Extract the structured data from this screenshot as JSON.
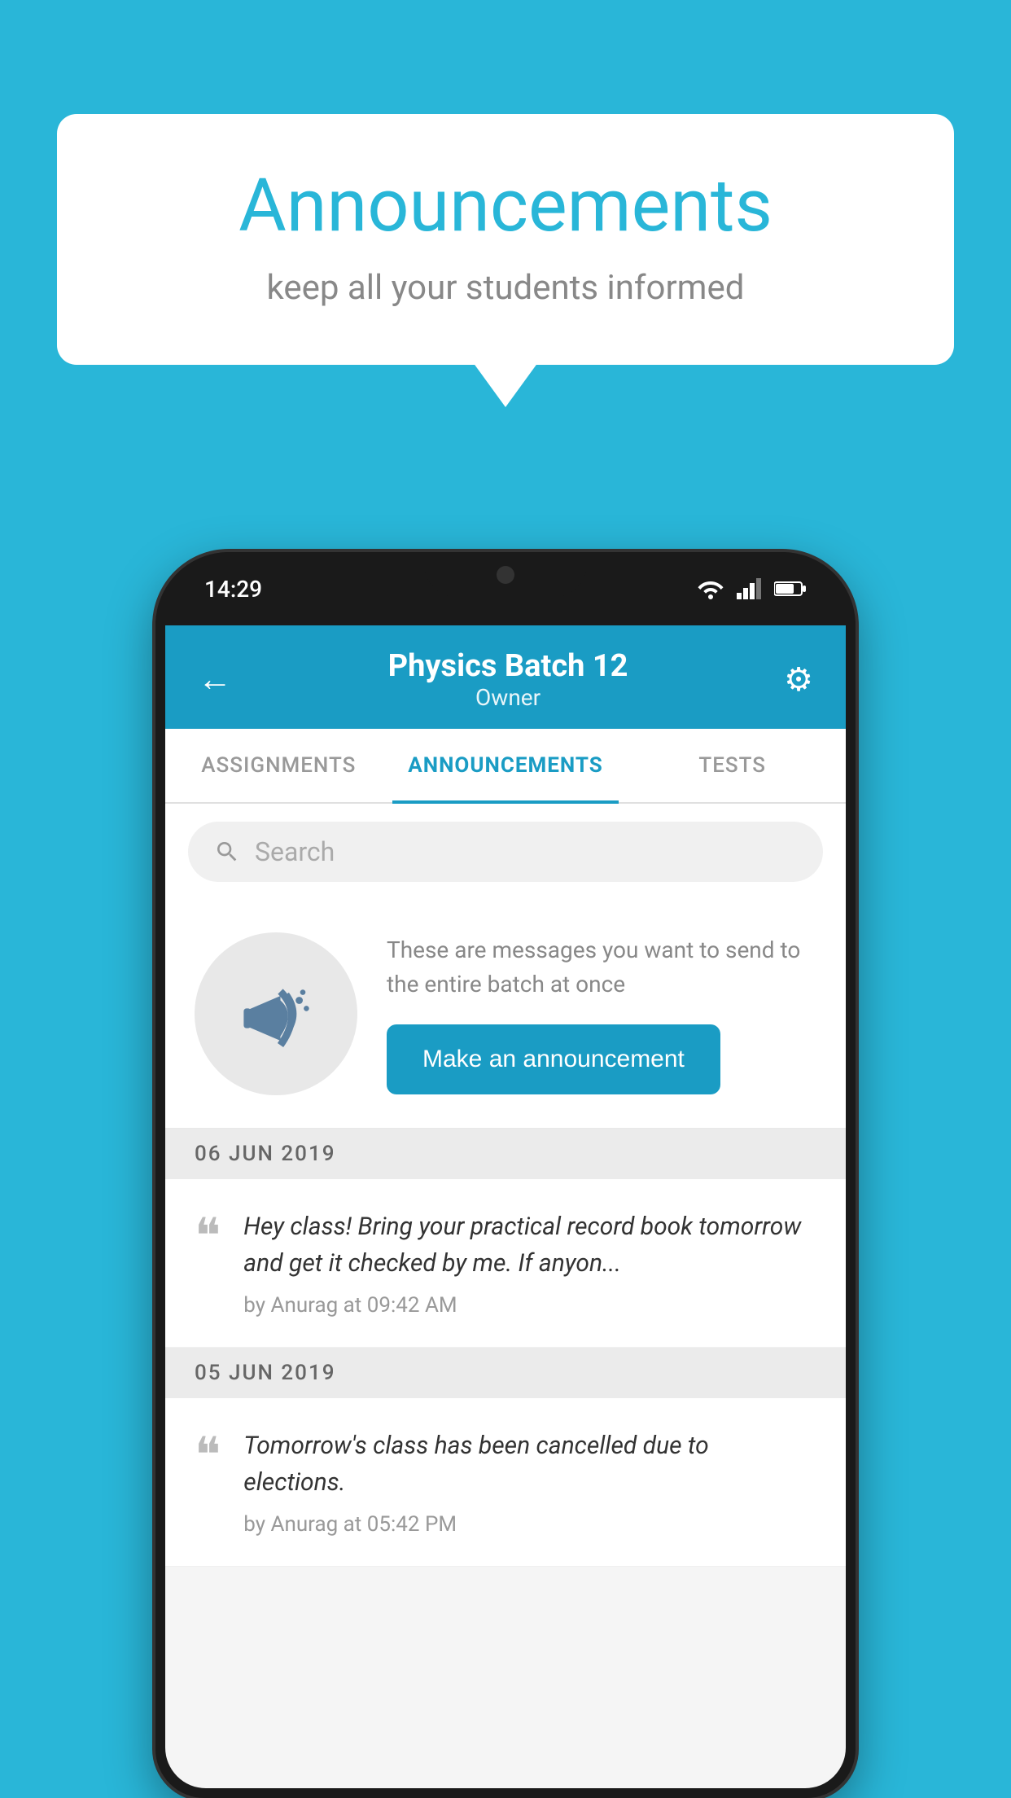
{
  "background_color": "#29b6d8",
  "speech_bubble": {
    "title": "Announcements",
    "subtitle": "keep all your students informed"
  },
  "phone": {
    "status_bar": {
      "time": "14:29"
    },
    "header": {
      "title": "Physics Batch 12",
      "subtitle": "Owner",
      "back_label": "←",
      "gear_label": "⚙"
    },
    "tabs": [
      {
        "label": "ASSIGNMENTS",
        "active": false
      },
      {
        "label": "ANNOUNCEMENTS",
        "active": true
      },
      {
        "label": "TESTS",
        "active": false
      }
    ],
    "search": {
      "placeholder": "Search"
    },
    "promo": {
      "description": "These are messages you want to send to the entire batch at once",
      "button_label": "Make an announcement"
    },
    "announcements": [
      {
        "date": "06  JUN  2019",
        "text": "Hey class! Bring your practical record book tomorrow and get it checked by me. If anyon...",
        "meta": "by Anurag at 09:42 AM"
      },
      {
        "date": "05  JUN  2019",
        "text": "Tomorrow's class has been cancelled due to elections.",
        "meta": "by Anurag at 05:42 PM"
      }
    ]
  }
}
